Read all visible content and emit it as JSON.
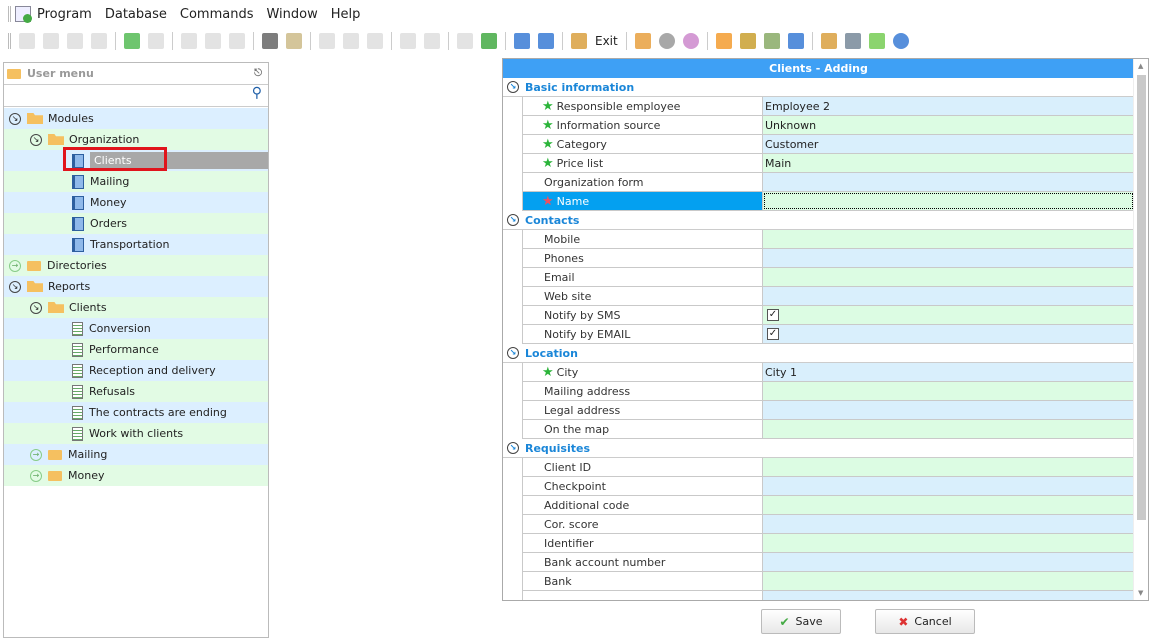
{
  "menubar": {
    "items": [
      "Program",
      "Database",
      "Commands",
      "Window",
      "Help"
    ]
  },
  "toolbar": {
    "exit_label": "Exit",
    "icons": [
      "add-icon",
      "copy-icon",
      "edit-icon",
      "delete-icon",
      "refresh-icon",
      "search-icon",
      "filter-icon",
      "filter-clear-icon",
      "filter-check-icon",
      "flag-icon",
      "image-icon",
      "expand-icon",
      "expand-all-icon",
      "collapse-all-icon",
      "add-column-icon",
      "note-icon",
      "download-icon",
      "excel-export-icon",
      "close-window-icon",
      "close-all-windows-icon",
      "exit-icon",
      "location-pin-icon",
      "settings-icon",
      "color-wheel-icon",
      "rss-icon",
      "lock-icon",
      "users-icon",
      "plug-icon",
      "table-icon",
      "print-icon",
      "play-icon",
      "info-icon"
    ]
  },
  "user_menu": {
    "title": "User menu",
    "tree": [
      {
        "label": "Modules",
        "level": 0,
        "type": "folder",
        "state": "open"
      },
      {
        "label": "Organization",
        "level": 1,
        "type": "folder",
        "state": "open"
      },
      {
        "label": "Clients",
        "level": 2,
        "type": "doc",
        "selected": true
      },
      {
        "label": "Mailing",
        "level": 2,
        "type": "doc"
      },
      {
        "label": "Money",
        "level": 2,
        "type": "doc"
      },
      {
        "label": "Orders",
        "level": 2,
        "type": "doc"
      },
      {
        "label": "Transportation",
        "level": 2,
        "type": "doc"
      },
      {
        "label": "Directories",
        "level": 0,
        "type": "folder",
        "state": "closed"
      },
      {
        "label": "Reports",
        "level": 0,
        "type": "folder",
        "state": "open"
      },
      {
        "label": "Clients",
        "level": 1,
        "type": "folder",
        "state": "open"
      },
      {
        "label": "Conversion",
        "level": 2,
        "type": "report"
      },
      {
        "label": "Performance",
        "level": 2,
        "type": "report"
      },
      {
        "label": "Reception and delivery",
        "level": 2,
        "type": "report"
      },
      {
        "label": "Refusals",
        "level": 2,
        "type": "report"
      },
      {
        "label": "The contracts are ending",
        "level": 2,
        "type": "report"
      },
      {
        "label": "Work with clients",
        "level": 2,
        "type": "report"
      },
      {
        "label": "Mailing",
        "level": 1,
        "type": "folder",
        "state": "closed"
      },
      {
        "label": "Money",
        "level": 1,
        "type": "folder",
        "state": "closed"
      }
    ]
  },
  "form": {
    "title": "Clients - Adding",
    "groups": [
      {
        "title": "Basic information",
        "rows": [
          {
            "label": "Responsible employee",
            "value": "Employee 2",
            "required": "green",
            "tone": "blue"
          },
          {
            "label": "Information source",
            "value": "Unknown",
            "required": "green",
            "tone": "green"
          },
          {
            "label": "Category",
            "value": "Customer",
            "required": "green",
            "tone": "blue"
          },
          {
            "label": "Price list",
            "value": "Main",
            "required": "green",
            "tone": "green"
          },
          {
            "label": "Organization form",
            "value": "",
            "tone": "blue"
          },
          {
            "label": "Name",
            "value": "",
            "required": "red",
            "tone": "green",
            "selected": true
          }
        ]
      },
      {
        "title": "Contacts",
        "rows": [
          {
            "label": "Mobile",
            "value": "",
            "tone": "green"
          },
          {
            "label": "Phones",
            "value": "",
            "tone": "blue"
          },
          {
            "label": "Email",
            "value": "",
            "tone": "green"
          },
          {
            "label": "Web site",
            "value": "",
            "tone": "blue"
          },
          {
            "label": "Notify by SMS",
            "checkbox": true,
            "checked": true,
            "tone": "green"
          },
          {
            "label": "Notify by EMAIL",
            "checkbox": true,
            "checked": true,
            "tone": "blue"
          }
        ]
      },
      {
        "title": "Location",
        "rows": [
          {
            "label": "City",
            "value": "City 1",
            "required": "green",
            "tone": "blue"
          },
          {
            "label": "Mailing address",
            "value": "",
            "tone": "green"
          },
          {
            "label": "Legal address",
            "value": "",
            "tone": "blue"
          },
          {
            "label": "On the map",
            "value": "",
            "tone": "green"
          }
        ]
      },
      {
        "title": "Requisites",
        "rows": [
          {
            "label": "Client ID",
            "value": "",
            "tone": "green"
          },
          {
            "label": "Checkpoint",
            "value": "",
            "tone": "blue"
          },
          {
            "label": "Additional code",
            "value": "",
            "tone": "green"
          },
          {
            "label": "Cor. score",
            "value": "",
            "tone": "blue"
          },
          {
            "label": "Identifier",
            "value": "",
            "tone": "green"
          },
          {
            "label": "Bank account number",
            "value": "",
            "tone": "blue"
          },
          {
            "label": "Bank",
            "value": "",
            "tone": "green"
          },
          {
            "label": "",
            "value": "",
            "tone": "blue"
          }
        ]
      }
    ]
  },
  "buttons": {
    "save": "Save",
    "cancel": "Cancel"
  },
  "colors": {
    "title_bar": "#3ea0f5",
    "group_title": "#1a86d8",
    "selected_row": "#04a0f0",
    "value_blue": "#d9effc",
    "value_green": "#dcfce3",
    "highlight": "#e0141c"
  }
}
